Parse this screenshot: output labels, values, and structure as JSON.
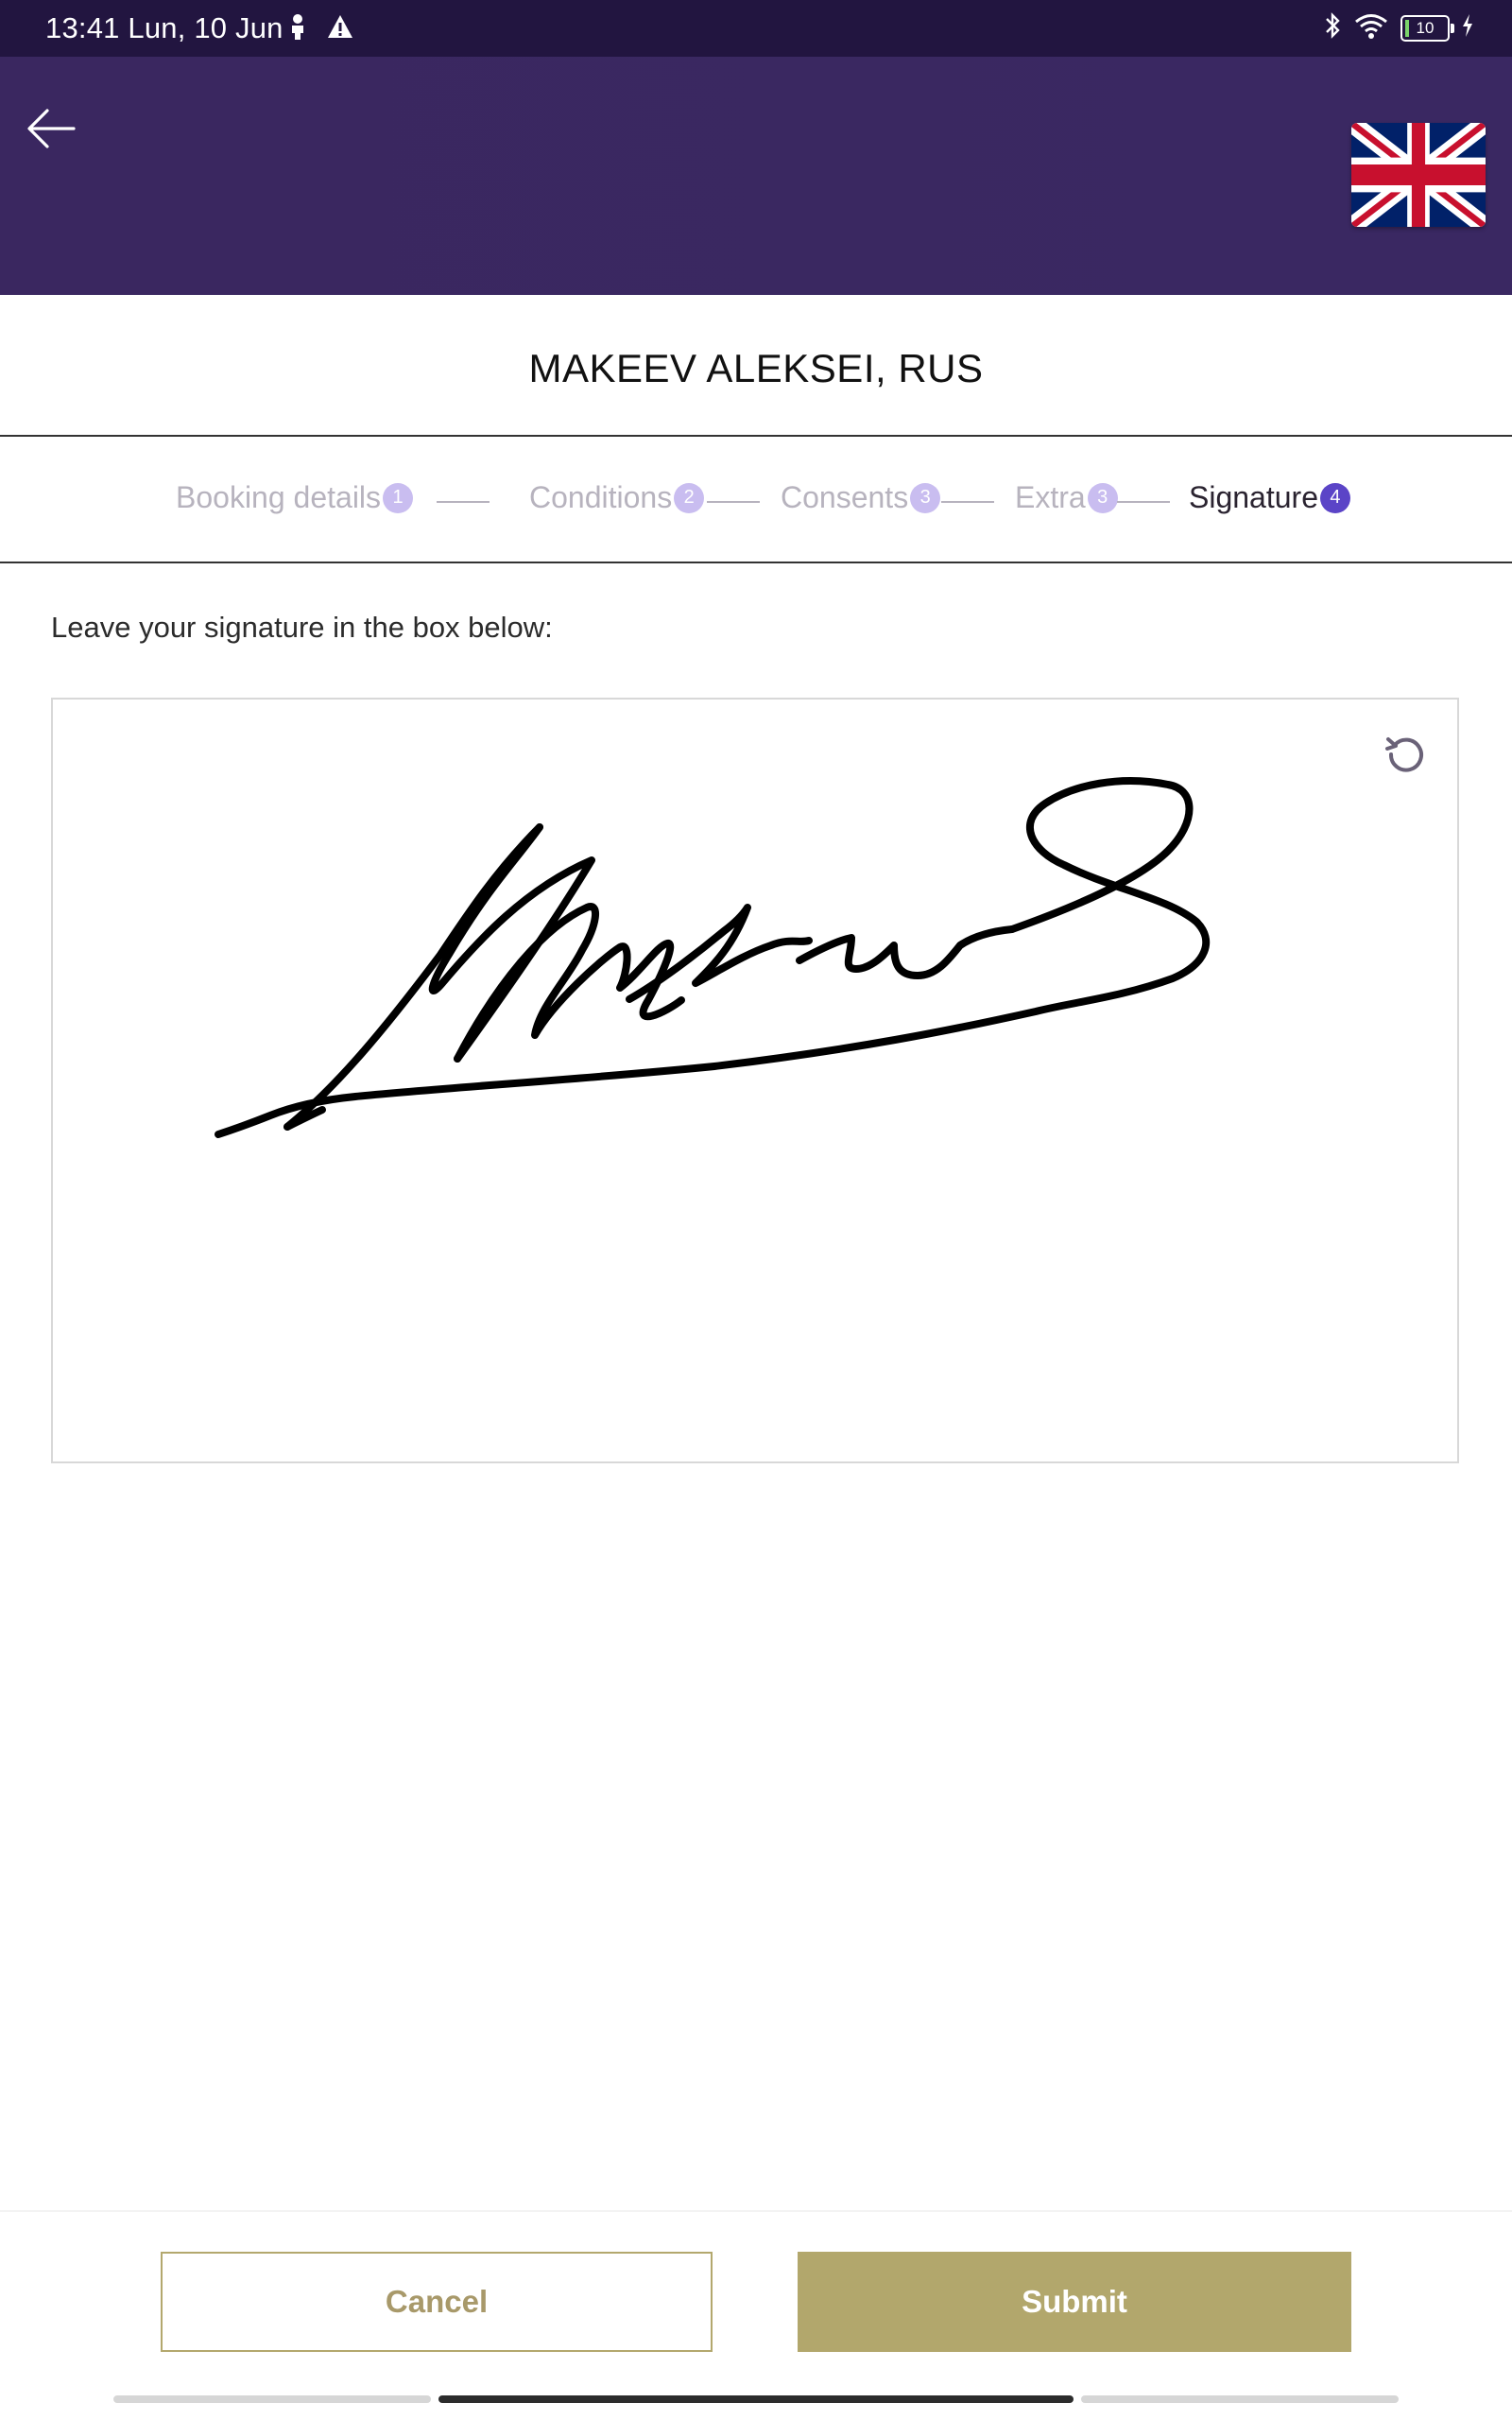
{
  "status_bar": {
    "time": "13:41 Lun, 10 Jun",
    "battery": "10",
    "icons": [
      "person-icon",
      "warning-icon",
      "bluetooth-icon",
      "wifi-icon",
      "battery-icon",
      "charging-icon"
    ]
  },
  "header": {
    "back_icon": "arrow-left-icon",
    "language_flag": "uk-flag",
    "colors": {
      "background": "#3a2862",
      "statusbar": "#221540"
    }
  },
  "guest": {
    "name": "MAKEEV ALEKSEI, RUS"
  },
  "steps": [
    {
      "label": "Booking details",
      "badge": "1",
      "active": false
    },
    {
      "label": "Conditions",
      "badge": "2",
      "active": false
    },
    {
      "label": "Consents",
      "badge": "3",
      "active": false
    },
    {
      "label": "Extra",
      "badge": "3",
      "active": false
    },
    {
      "label": "Signature",
      "badge": "4",
      "active": true
    }
  ],
  "signature": {
    "instruction": "Leave your signature in the box below:",
    "reset_icon": "refresh-icon",
    "has_signature": true
  },
  "footer": {
    "cancel_label": "Cancel",
    "submit_label": "Submit",
    "colors": {
      "accent": "#b2a76c"
    }
  }
}
